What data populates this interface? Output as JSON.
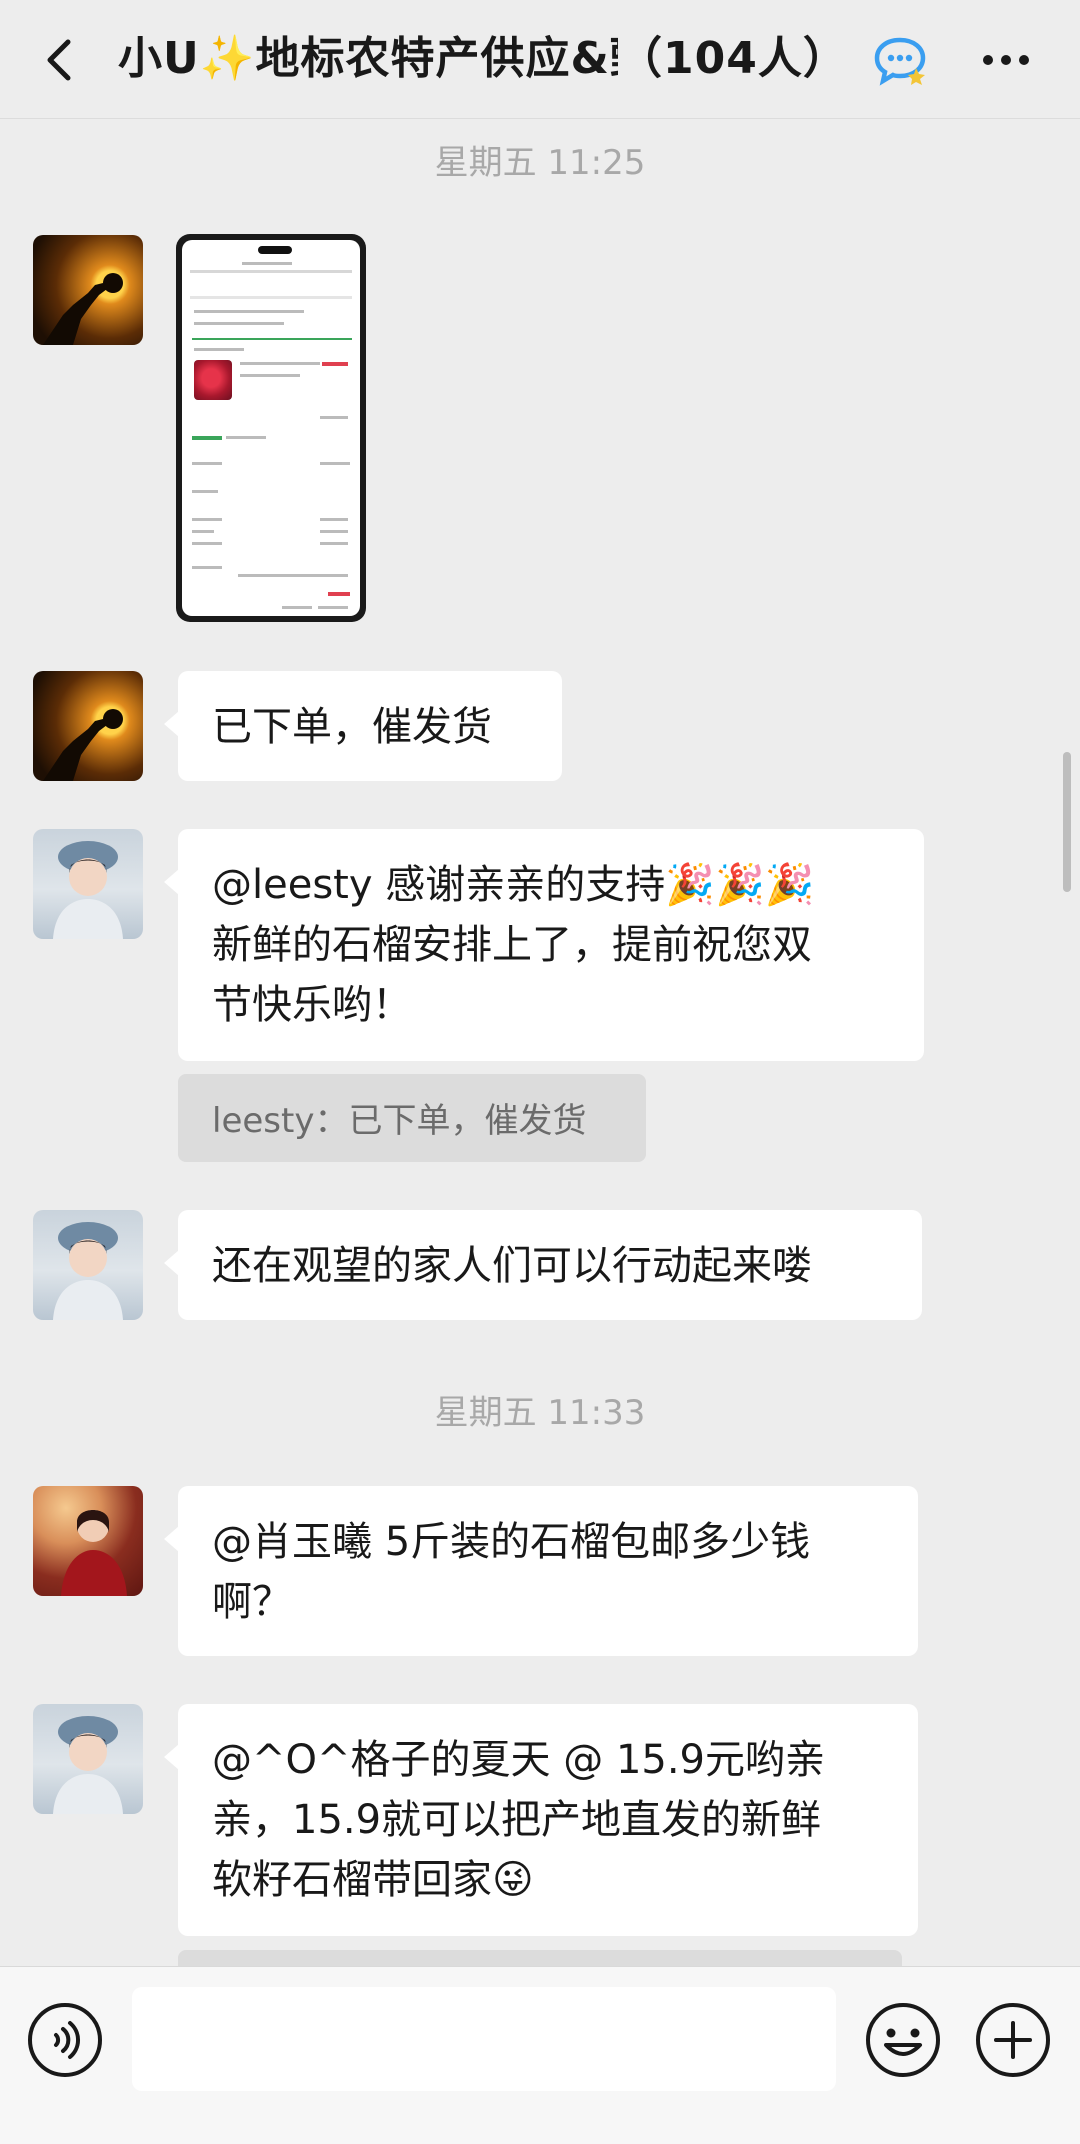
{
  "header": {
    "group_name": "小U✨地标农特产供应&甄",
    "member_count": "（104人）"
  },
  "timestamps": [
    "星期五 11:25",
    "星期五 11:33"
  ],
  "messages": [
    {
      "type": "image",
      "sender_avatar": "silhouette-avatar"
    },
    {
      "type": "text",
      "text": "已下单，催发货"
    },
    {
      "type": "text",
      "line1": "@leesty 感谢亲亲的支持",
      "emoji1": "🎉🎉🎉",
      "line2": "新鲜的石榴安排上了，提前祝您双",
      "line3": "节快乐哟！",
      "quote": "leesty：已下单，催发货"
    },
    {
      "type": "text",
      "text": "还在观望的家人们可以行动起来喽"
    },
    {
      "type": "text",
      "line1": "@肖玉曦 5斤装的石榴包邮多少钱",
      "line2": "啊？"
    },
    {
      "type": "text",
      "line1": "@^O^格子的夏天 @ 15.9元哟亲",
      "line2": "亲，15.9就可以把产地直发的新鲜",
      "line3": "软籽石榴带回家",
      "emoji": "😜"
    }
  ],
  "input": {
    "value": "",
    "placeholder": ""
  },
  "icons": {
    "back": "chevron-left-icon",
    "chat": "chat-bubble-icon",
    "more": "more-icon",
    "voice": "voice-icon",
    "emoji": "emoji-icon",
    "plus": "plus-icon"
  },
  "colors": {
    "background": "#ededed",
    "bubble": "#ffffff",
    "quote": "#dcdcdc",
    "accent": "#3a9ef0"
  }
}
